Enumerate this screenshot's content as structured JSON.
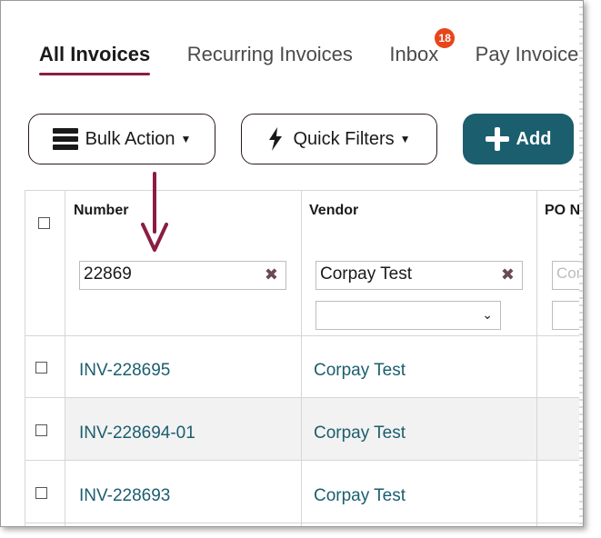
{
  "tabs": [
    {
      "label": "All Invoices",
      "active": true
    },
    {
      "label": "Recurring Invoices"
    },
    {
      "label": "Inbox",
      "badge": "18"
    },
    {
      "label": "Pay Invoices"
    }
  ],
  "toolbar": {
    "bulk_action": "Bulk Action",
    "quick_filters": "Quick Filters",
    "add": "Add"
  },
  "columns": [
    "Number",
    "Vendor",
    "PO Nu"
  ],
  "filters": {
    "number": "22869",
    "vendor": "Corpay Test",
    "po_placeholder": "Cont"
  },
  "rows": [
    {
      "number": "INV-228695",
      "vendor": "Corpay Test"
    },
    {
      "number": "INV-228694-01",
      "vendor": "Corpay Test"
    },
    {
      "number": "INV-228693",
      "vendor": "Corpay Test"
    }
  ],
  "colors": {
    "accent": "#8b1d42",
    "primary_button": "#1b5e6e",
    "link": "#1b5e6e",
    "badge": "#e8451b"
  }
}
